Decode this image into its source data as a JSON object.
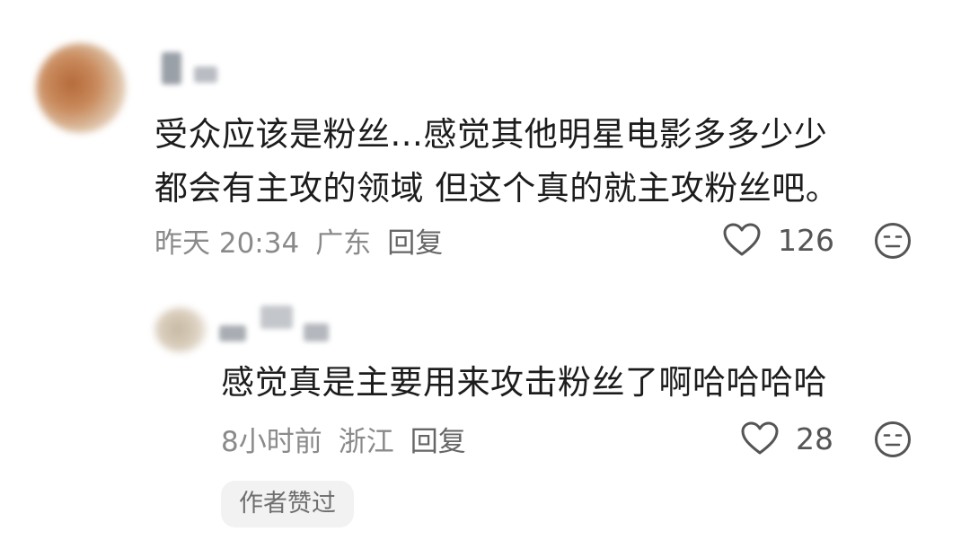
{
  "comment": {
    "text_line1": "受众应该是粉丝...感觉其他明星电影多多少少",
    "text_line2": "都会有主攻的领域 但这个真的就主攻粉丝吧。",
    "time": "昨天 20:34",
    "location": "广东",
    "reply_label": "回复",
    "likes": "126"
  },
  "reply": {
    "text": "感觉真是主要用来攻击粉丝了啊哈哈哈哈",
    "time": "8小时前",
    "location": "浙江",
    "reply_label": "回复",
    "likes": "28",
    "author_badge": "作者赞过"
  },
  "icons": {
    "like": "heart-outline-icon",
    "dislike": "meh-face-icon"
  },
  "colors": {
    "meta_text": "#8a8a8a",
    "badge_bg": "#f2f2f2"
  }
}
